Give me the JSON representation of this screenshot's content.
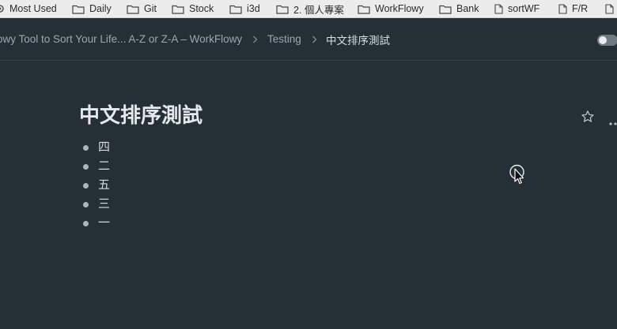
{
  "bookmarks": [
    {
      "label": "Most Used",
      "icon": "gear-icon"
    },
    {
      "label": "Daily",
      "icon": "folder-icon"
    },
    {
      "label": "Git",
      "icon": "folder-icon"
    },
    {
      "label": "Stock",
      "icon": "folder-icon"
    },
    {
      "label": "i3d",
      "icon": "folder-icon"
    },
    {
      "label": "2. 個人專案",
      "icon": "folder-icon"
    },
    {
      "label": "WorkFlowy",
      "icon": "folder-icon"
    },
    {
      "label": "Bank",
      "icon": "folder-icon"
    },
    {
      "label": "sortWF",
      "icon": "page-icon"
    },
    {
      "label": "F/R",
      "icon": "page-icon"
    }
  ],
  "breadcrumb": {
    "items": [
      "owy Tool to Sort Your Life... A-Z or Z-A – WorkFlowy",
      "Testing",
      "中文排序測試"
    ]
  },
  "page": {
    "title": "中文排序測試",
    "items": [
      "四",
      "二",
      "五",
      "三",
      "一"
    ]
  },
  "colors": {
    "background": "#252f36",
    "bookmarks_bar": "#ececec",
    "title_text": "#e5e9ec",
    "muted_text": "#9aa7b0"
  }
}
